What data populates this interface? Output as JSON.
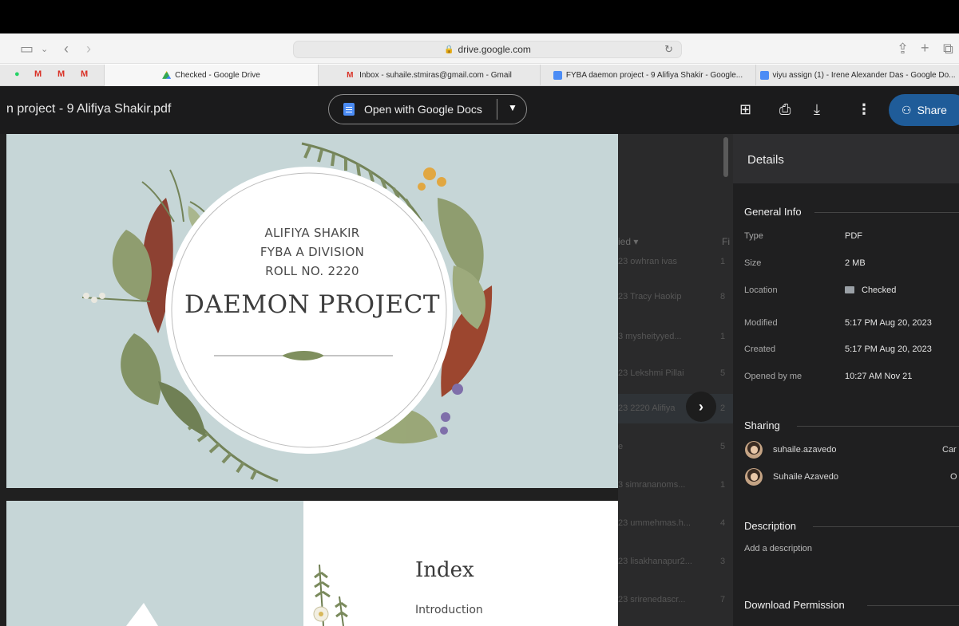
{
  "browser": {
    "url": "drive.google.com"
  },
  "tabs": [
    {
      "label": "Checked - Google Drive",
      "active": true,
      "icon": "drive-icon"
    },
    {
      "label": "Inbox - suhaile.stmiras@gmail.com - Gmail",
      "active": false,
      "icon": "gmail-icon"
    },
    {
      "label": "FYBA daemon project - 9 Alifiya Shakir - Google...",
      "active": false,
      "icon": "docs-icon"
    },
    {
      "label": "viyu assign (1) - Irene Alexander Das - Google Do...",
      "active": false,
      "icon": "docs-icon"
    }
  ],
  "pinned": [
    "whatsapp-icon",
    "gmail-icon",
    "gmail-icon",
    "gmail-icon"
  ],
  "viewer": {
    "file_title": "n project - 9 Alifiya Shakir.pdf",
    "open_with_label": "Open with Google Docs",
    "share_label": "Share"
  },
  "pdf": {
    "page1": {
      "name": "ALIFIYA SHAKIR",
      "division": "FYBA A DIVISION",
      "roll": "ROLL NO. 2220",
      "heading": "DAEMON PROJECT"
    },
    "page2": {
      "heading": "Index",
      "first_item": "Introduction"
    }
  },
  "bg_list": {
    "header": "ied ▾",
    "header2": "Fi",
    "rows": [
      {
        "owner": "23 owhran ivas",
        "size": "1"
      },
      {
        "owner": "23 Tracy Haokip",
        "size": "8"
      },
      {
        "owner": "3 mysheityyed...",
        "size": "1"
      },
      {
        "owner": "23 Lekshmi Pillai",
        "size": "5"
      },
      {
        "owner": "23 2220 Alifiya",
        "size": "2"
      },
      {
        "owner": "e",
        "size": "5"
      },
      {
        "owner": "3 simrananoms...",
        "size": "1"
      },
      {
        "owner": "23 ummehmas.h...",
        "size": "4"
      },
      {
        "owner": "23 lisakhanapur2...",
        "size": "3"
      },
      {
        "owner": "23 srirenedascr...",
        "size": "7"
      }
    ]
  },
  "details": {
    "title": "Details",
    "general_info_label": "General Info",
    "fields": [
      {
        "key": "Type",
        "value": "PDF"
      },
      {
        "key": "Size",
        "value": "2 MB"
      },
      {
        "key": "Location",
        "value": "Checked"
      },
      {
        "key": "Modified",
        "value": "5:17 PM Aug 20, 2023"
      },
      {
        "key": "Created",
        "value": "5:17 PM Aug 20, 2023"
      },
      {
        "key": "Opened by me",
        "value": "10:27 AM Nov 21"
      }
    ],
    "sharing_label": "Sharing",
    "people": [
      {
        "name": "suhaile.azavedo",
        "role": "Car"
      },
      {
        "name": "Suhaile Azavedo",
        "role": "O"
      }
    ],
    "description_label": "Description",
    "description_placeholder": "Add a description",
    "download_permission_label": "Download Permission"
  },
  "colors": {
    "header_bg": "#1b1b1c",
    "share_blue": "#1f5c99",
    "page_bg": "#c6d6d7",
    "panel_bg": "#1f1f20"
  }
}
